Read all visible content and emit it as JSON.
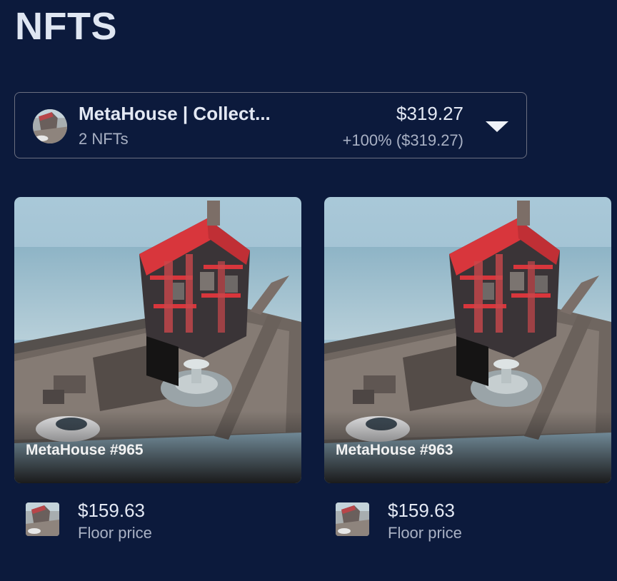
{
  "page": {
    "title": "NFTS"
  },
  "collection": {
    "name": "MetaHouse | Collect...",
    "count_label": "2 NFTs",
    "value": "$319.27",
    "change": "+100% ($319.27)",
    "expand_icon": "chevron-down-icon"
  },
  "nfts": [
    {
      "name": "MetaHouse #965",
      "price": "$159.63",
      "price_caption": "Floor price"
    },
    {
      "name": "MetaHouse #963",
      "price": "$159.63",
      "price_caption": "Floor price"
    }
  ],
  "colors": {
    "background": "#0c1a3c",
    "border": "#6b6f80",
    "primary_text": "#e3e8f3",
    "secondary_text": "#a9b1c4",
    "house_red": "#d8363c"
  }
}
